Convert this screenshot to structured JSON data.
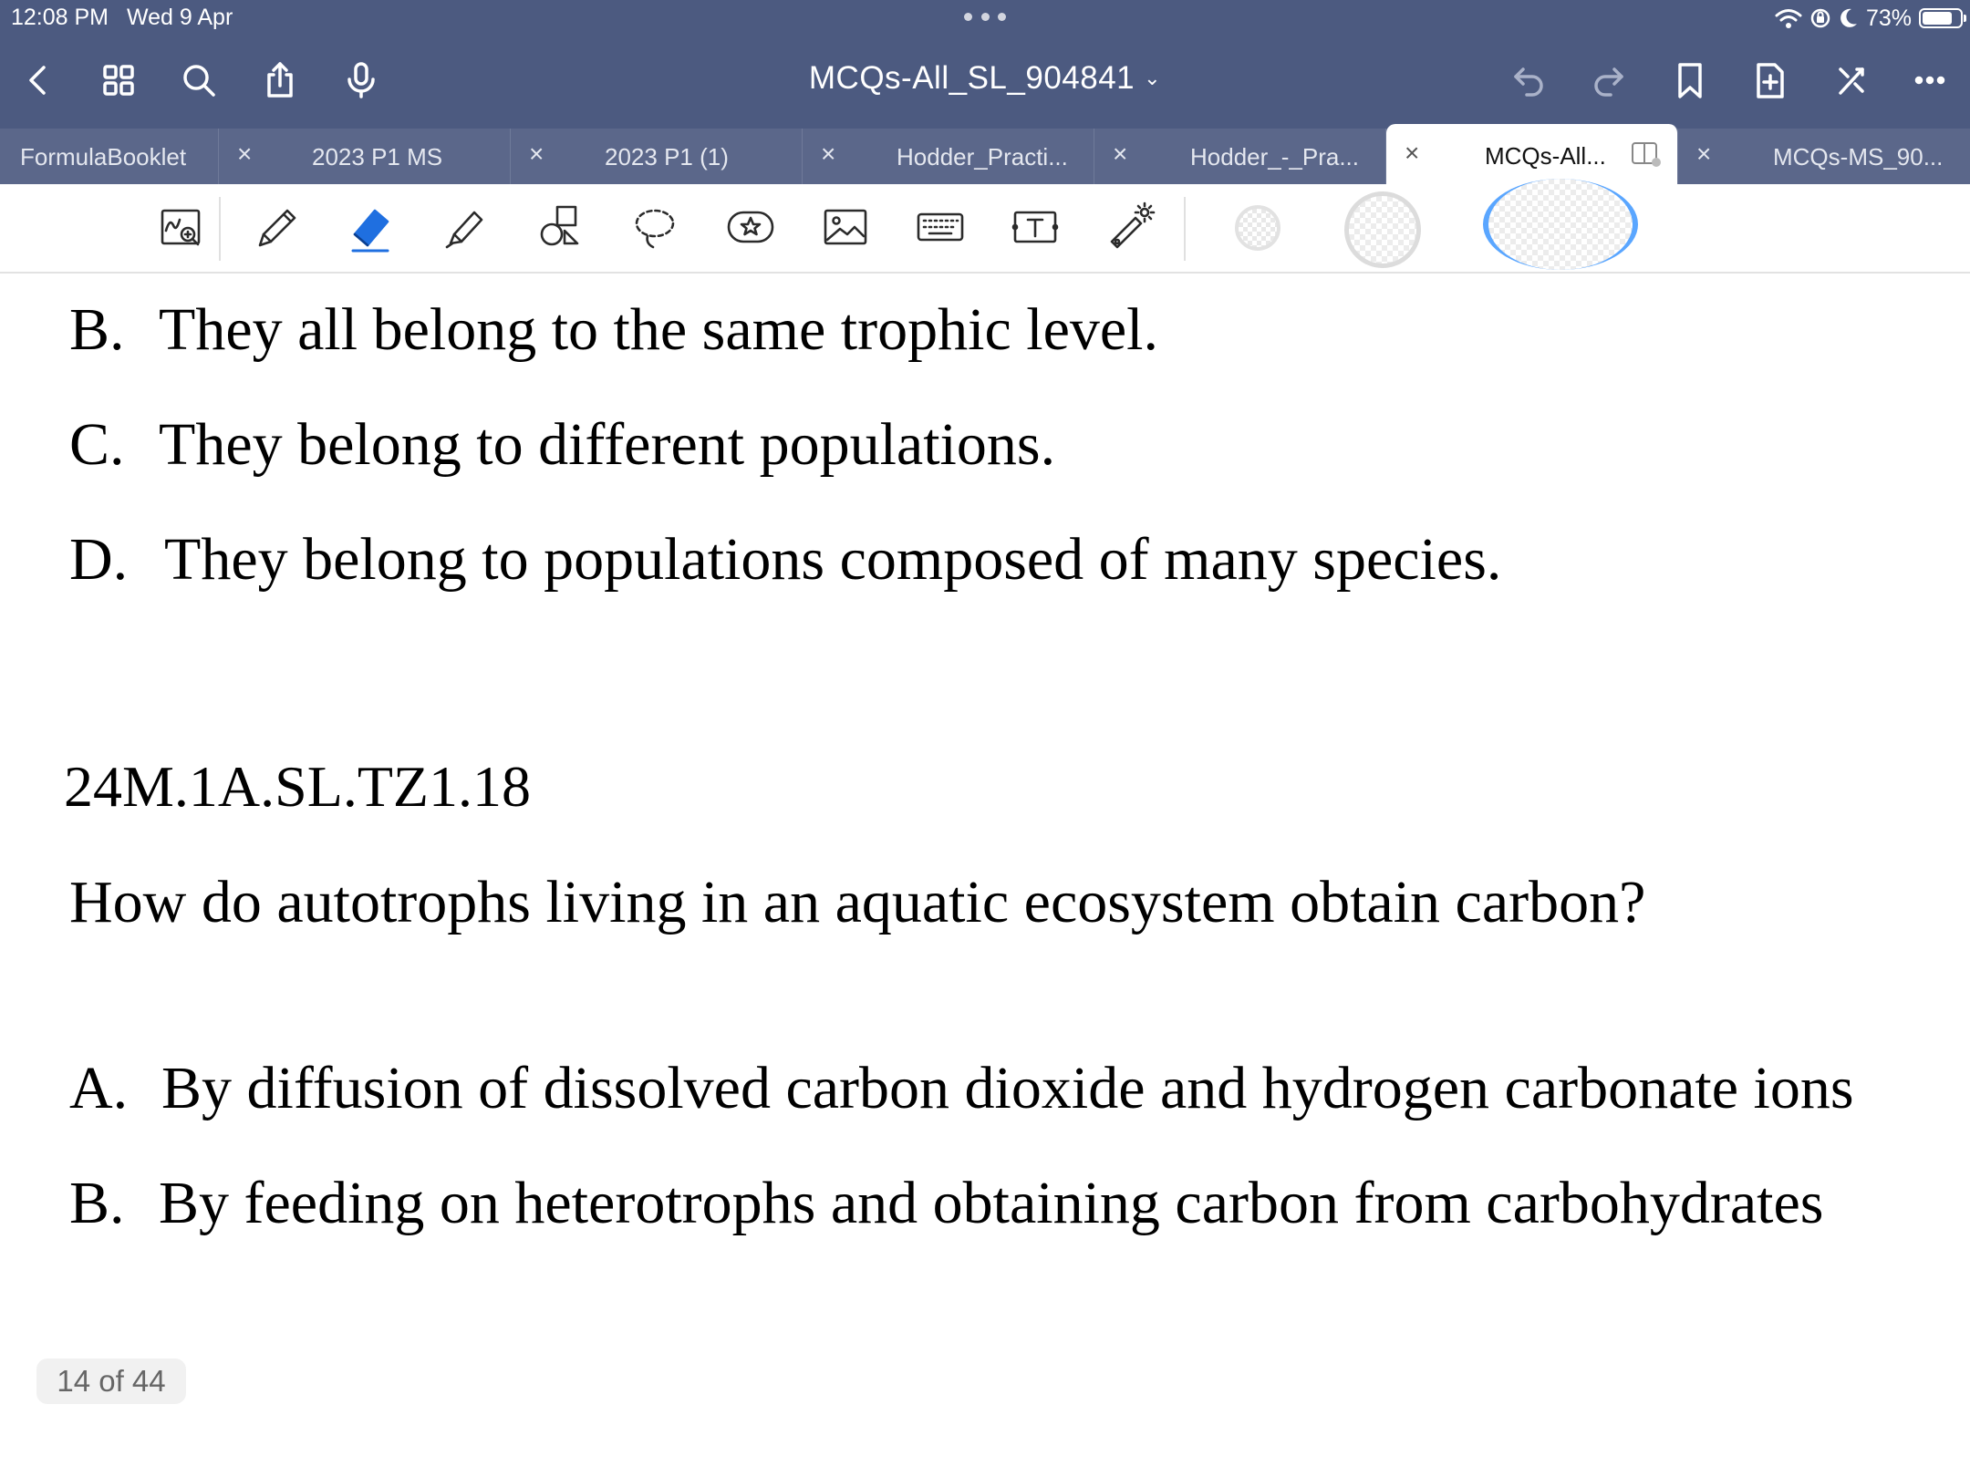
{
  "status": {
    "time": "12:08 PM",
    "date": "Wed 9 Apr",
    "battery": "73%",
    "battery_level": 0.73
  },
  "titlebar": {
    "title": "MCQs-All_SL_904841",
    "left_icons": [
      "back-chevron-icon",
      "grid-icon",
      "search-icon",
      "share-icon",
      "microphone-icon"
    ],
    "right_icons": [
      "undo-icon",
      "redo-icon",
      "bookmark-icon",
      "add-page-icon",
      "close-pen-icon",
      "more-icon"
    ]
  },
  "tabs": [
    {
      "label": "FormulaBooklet",
      "active": false
    },
    {
      "label": "2023 P1 MS",
      "active": false
    },
    {
      "label": "2023 P1  (1)",
      "active": false
    },
    {
      "label": "Hodder_Practi...",
      "active": false
    },
    {
      "label": "Hodder_-_Pra...",
      "active": false
    },
    {
      "label": "MCQs-All...",
      "active": true
    },
    {
      "label": "MCQs-MS_90...",
      "active": false
    }
  ],
  "tools": [
    "handwriting-zoom-icon",
    "pen-icon",
    "eraser-icon",
    "highlighter-icon",
    "shapes-icon",
    "lasso-icon",
    "sticker-icon",
    "image-icon",
    "keyboard-icon",
    "text-box-icon",
    "laser-pointer-icon"
  ],
  "colors": {
    "titlebar_bg": "#4c5a80",
    "tabbar_bg": "#5b678a",
    "eraser_active": "#1f6fe0",
    "selected_ring": "#5aa6ff"
  },
  "content": {
    "prev_options": [
      {
        "letter": "B.",
        "text": "They all belong to the same trophic level."
      },
      {
        "letter": "C.",
        "text": "They belong to different populations."
      },
      {
        "letter": "D.",
        "text": "They belong to populations composed of many species."
      }
    ],
    "question_id": "24M.1A.SL.TZ1.18",
    "question": "How do autotrophs living in an aquatic ecosystem obtain carbon?",
    "options": [
      {
        "letter": "A.",
        "text": "By diffusion of dissolved carbon dioxide and hydrogen carbonate ions"
      },
      {
        "letter": "B.",
        "text": "By feeding on heterotrophs and obtaining carbon from carbohydrates"
      }
    ]
  },
  "page_counter": "14 of 44"
}
